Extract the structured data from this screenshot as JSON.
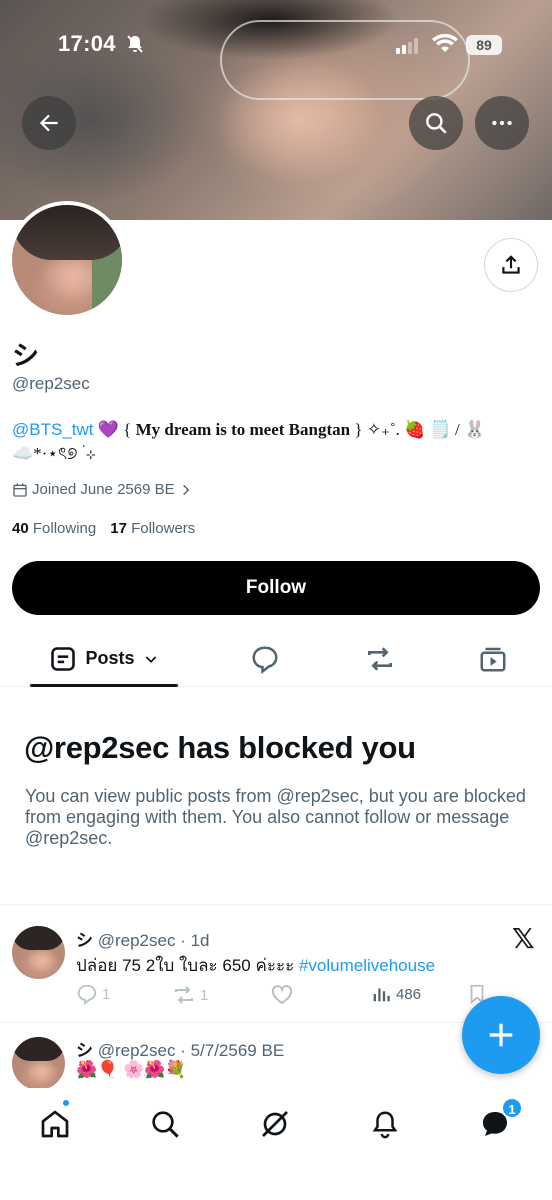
{
  "status_bar": {
    "time": "17:04",
    "battery": "89"
  },
  "profile": {
    "display_name": "シ",
    "handle": "@rep2sec",
    "bio_mention": "@BTS_twt",
    "bio_text_1": " 💜 { ",
    "bio_bold": "My dream is to meet Bangtan",
    "bio_text_2": " } ✧₊˚. 🍓 🗒️ / 🐰",
    "bio_line2": "☁️*·⋆ৎ୭ ࣪ ⊹",
    "joined": "Joined June 2569 BE",
    "following_count": "40",
    "following_label": "Following",
    "followers_count": "17",
    "followers_label": "Followers",
    "follow_button": "Follow"
  },
  "tabs": {
    "posts_label": "Posts"
  },
  "blocked": {
    "title": "@rep2sec has blocked you",
    "text": "You can view public posts from @rep2sec, but you are blocked from engaging with them. You also cannot follow or message @rep2sec."
  },
  "posts": [
    {
      "name": "シ",
      "handle_time": "@rep2sec · 1d",
      "text": "ปล่อย 75 2ใบ ใบละ 650 ค่ะะะ ",
      "hashtag": "#volumelivehouse",
      "replies": "1",
      "reposts": "1",
      "views": "486"
    },
    {
      "name": "シ",
      "handle_time": "@rep2sec · 5/7/2569 BE",
      "text": "🌺🎈 🌸🌺💐"
    }
  ],
  "nav": {
    "messages_badge": "1"
  },
  "colors": {
    "accent": "#1d9bf0",
    "text": "#0f1419",
    "muted": "#536471"
  }
}
